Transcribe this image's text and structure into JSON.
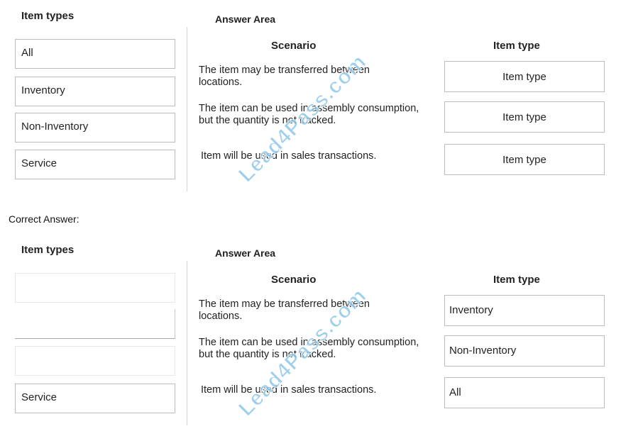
{
  "question": {
    "item_types_heading": "Item types",
    "answer_area_heading": "Answer Area",
    "scenario_column_heading": "Scenario",
    "item_type_column_heading": "Item type",
    "source_items": [
      "All",
      "Inventory",
      "Non-Inventory",
      "Service"
    ],
    "scenarios": [
      {
        "line1": "The item may be transferred between",
        "line2": "locations.",
        "target": "Item type"
      },
      {
        "line1": "The item can be used in assembly consumption,",
        "line2": "but the quantity is not tracked.",
        "target": "Item type"
      },
      {
        "line1": "Item will be used in sales transactions.",
        "line2": "",
        "target": "Item type"
      }
    ]
  },
  "correct_answer_label": "Correct Answer:",
  "answer": {
    "item_types_heading": "Item types",
    "answer_area_heading": "Answer Area",
    "scenario_column_heading": "Scenario",
    "item_type_column_heading": "Item type",
    "source_items": [
      "",
      "",
      "",
      "Service"
    ],
    "scenarios": [
      {
        "line1": "The item may be transferred between",
        "line2": "locations.",
        "target": "Inventory"
      },
      {
        "line1": "The item can be used in assembly consumption,",
        "line2": "but the quantity is not tracked.",
        "target": "Non-Inventory"
      },
      {
        "line1": "Item will be used in sales transactions.",
        "line2": "",
        "target": "All"
      }
    ]
  },
  "watermark": {
    "text": "Lead4Pass.com",
    "color": "#8ec8ea"
  }
}
